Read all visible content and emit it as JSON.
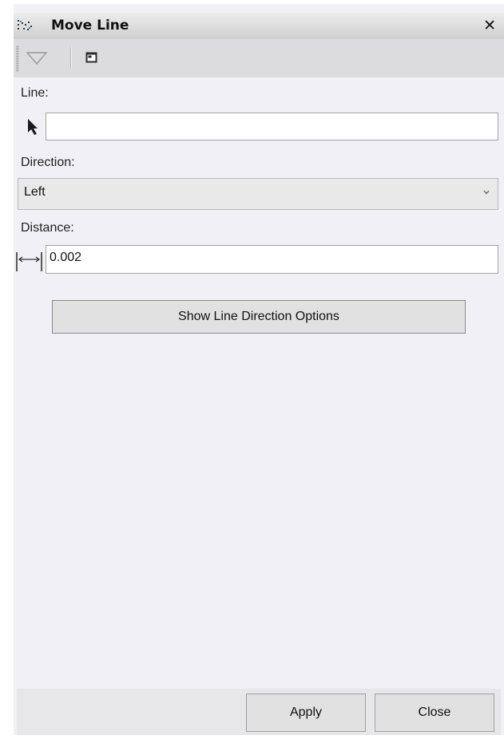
{
  "window": {
    "title": "Move Line",
    "close_symbol": "✕",
    "title_icon": "move-line-tool-icon"
  },
  "toolbar": {
    "dropdown_icon": "triangle-down-icon",
    "window_icon": "window-icon"
  },
  "form": {
    "line_label": "Line:",
    "line_value": "",
    "line_icon": "arrow-pointer-icon",
    "direction_label": "Direction:",
    "direction_value": "Left",
    "distance_label": "Distance:",
    "distance_value": "0.002",
    "distance_icon": "horizontal-measure-icon"
  },
  "buttons": {
    "show_options": "Show Line Direction Options",
    "apply": "Apply",
    "close": "Close"
  }
}
